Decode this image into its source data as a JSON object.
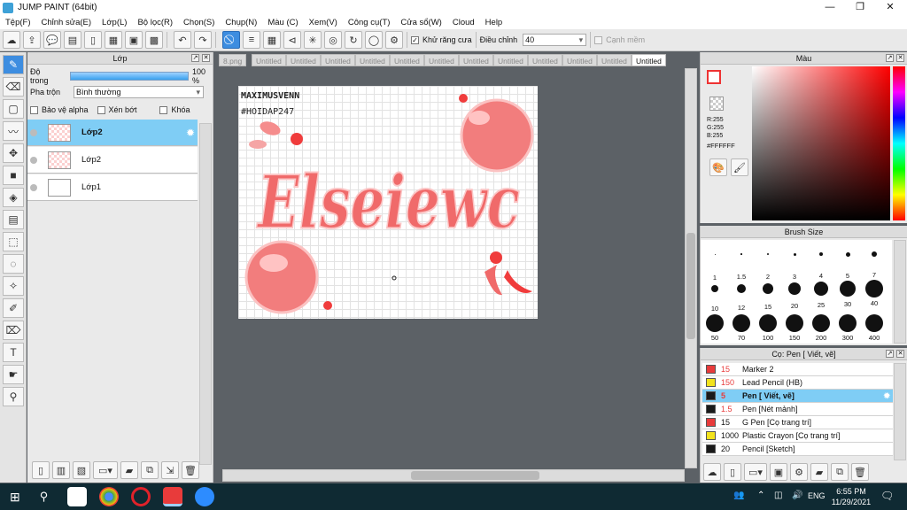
{
  "window": {
    "title": "JUMP PAINT (64bit)"
  },
  "menu": [
    "Tệp(F)",
    "Chỉnh sửa(E)",
    "Lớp(L)",
    "Bộ lọc(R)",
    "Chọn(S)",
    "Chụp(N)",
    "Màu (C)",
    "Xem(V)",
    "Công cụ(T)",
    "Cửa sổ(W)",
    "Cloud",
    "Help"
  ],
  "toolbar": {
    "antialias_label": "Khử răng cưa",
    "adjust_label": "Điều chỉnh",
    "adjust_value": "40",
    "smooth_label": "Cạnh mềm"
  },
  "layer_panel": {
    "title": "Lớp",
    "opacity_label": "Độ trong",
    "opacity_value": "100 %",
    "opacity_fraction": 1.0,
    "blend_label": "Pha trộn",
    "blend_value": "Bình thường",
    "protect_alpha": "Bảo vệ alpha",
    "clipping": "Xén bớt",
    "lock": "Khóa",
    "layers": [
      {
        "name": "Lớp2",
        "selected": true
      },
      {
        "name": "Lớp2",
        "selected": false
      },
      {
        "name": "Lớp1",
        "selected": false
      }
    ]
  },
  "doc_tabs": [
    "8.png",
    "Untitled",
    "Untitled",
    "Untitled",
    "Untitled",
    "Untitled",
    "Untitled",
    "Untitled",
    "Untitled",
    "Untitled",
    "Untitled",
    "Untitled",
    "Untitled"
  ],
  "canvas_art": {
    "line1": "MAXIMUSVENN",
    "line2": "#HOIDAP247",
    "word": "Elseiewc"
  },
  "color_panel": {
    "title": "Màu",
    "r": "R:255",
    "g": "G:255",
    "b": "B:255",
    "hex": "#FFFFFF"
  },
  "brush_size": {
    "title": "Brush Size",
    "sizes": [
      "1",
      "1.5",
      "2",
      "3",
      "4",
      "5",
      "7",
      "10",
      "12",
      "15",
      "20",
      "25",
      "30",
      "40",
      "50",
      "70",
      "100",
      "150",
      "200",
      "300",
      "400"
    ]
  },
  "brush_panel": {
    "title": "Cọ: Pen [ Viết, vẽ]",
    "brushes": [
      {
        "size": "15",
        "name": "Marker 2",
        "color": "#e83b3b",
        "size_color": "#e83b3b"
      },
      {
        "size": "150",
        "name": "Lead Pencil (HB)",
        "color": "#f2e21c",
        "size_color": "#e83b3b"
      },
      {
        "size": "5",
        "name": "Pen [ Viết, vẽ]",
        "color": "#1a1a1a",
        "size_color": "#e83b3b",
        "selected": true
      },
      {
        "size": "1.5",
        "name": "Pen [Nét mảnh]",
        "color": "#1a1a1a",
        "size_color": "#e83b3b"
      },
      {
        "size": "15",
        "name": "G Pen [Cọ trang trí]",
        "color": "#e83b3b",
        "size_color": "#111"
      },
      {
        "size": "1000",
        "name": "Plastic Crayon [Cọ trang trí]",
        "color": "#f2e21c",
        "size_color": "#111"
      },
      {
        "size": "20",
        "name": "Pencil [Sketch]",
        "color": "#1a1a1a",
        "size_color": "#111"
      }
    ]
  },
  "taskbar": {
    "lang": "ENG",
    "time": "6:55 PM",
    "date": "11/29/2021"
  }
}
